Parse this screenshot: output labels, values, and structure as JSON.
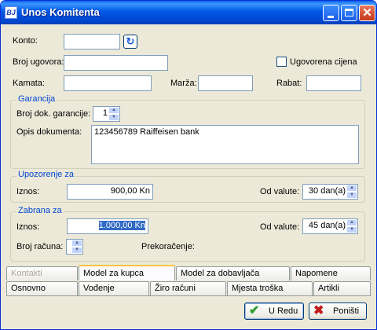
{
  "window": {
    "title": "Unos Komitenta",
    "icon_text": "BJ"
  },
  "konto": {
    "label": "Konto:",
    "value": ""
  },
  "broj_ugovora": {
    "label": "Broj ugovora:",
    "value": ""
  },
  "ugovorena_cijena": {
    "label": "Ugovorena cijena",
    "checked": false
  },
  "kamata": {
    "label": "Kamata:",
    "value": ""
  },
  "marza": {
    "label": "Marža:",
    "value": ""
  },
  "rabat": {
    "label": "Rabat:",
    "value": ""
  },
  "garancija": {
    "title": "Garancija",
    "broj_label": "Broj dok. garancije:",
    "broj_value": "1",
    "opis_label": "Opis dokumenta:",
    "opis_value": "123456789 Raiffeisen bank"
  },
  "upozorenje": {
    "title": "Upozorenje za",
    "iznos_label": "Iznos:",
    "iznos_value": "900,00 Kn",
    "od_valute_label": "Od valute:",
    "od_valute_value": "30 dan(a)"
  },
  "zabrana": {
    "title": "Zabrana za",
    "iznos_label": "Iznos:",
    "iznos_value": "1.000,00 Kn",
    "od_valute_label": "Od valute:",
    "od_valute_value": "45 dan(a)",
    "broj_racuna_label": "Broj računa:",
    "broj_racuna_value": "",
    "prekoracenje_label": "Prekoračenje:"
  },
  "tabs_top": [
    "Kontakti",
    "Model za kupca",
    "Model za dobavljača",
    "Napomene"
  ],
  "tabs_bottom": [
    "Osnovno",
    "Vođenje",
    "Žiro računi",
    "Mjesta troška",
    "Artikli"
  ],
  "buttons": {
    "ok": "U Redu",
    "cancel": "Poništi"
  }
}
